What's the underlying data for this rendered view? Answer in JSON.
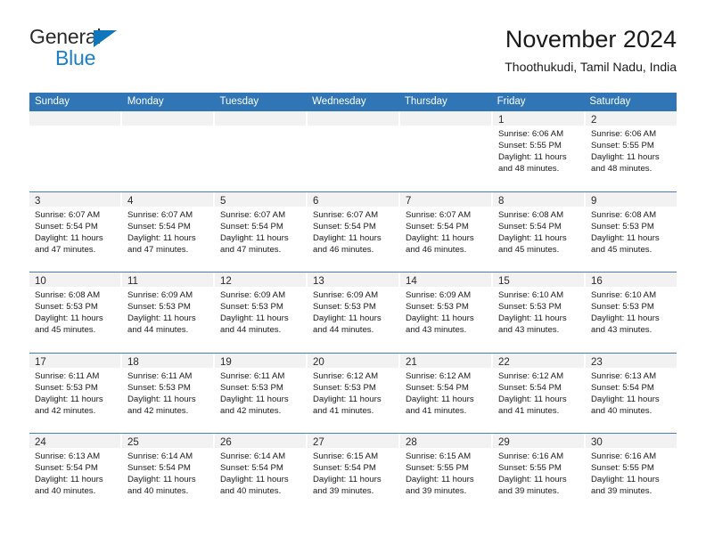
{
  "brand": {
    "name_top": "General",
    "name_bottom": "Blue",
    "accent_color": "#1b80c4"
  },
  "header": {
    "title": "November 2024",
    "subtitle": "Thoothukudi, Tamil Nadu, India"
  },
  "calendar": {
    "header_color": "#3075b5",
    "weekdays": [
      "Sunday",
      "Monday",
      "Tuesday",
      "Wednesday",
      "Thursday",
      "Friday",
      "Saturday"
    ],
    "weeks": [
      [
        {
          "day": "",
          "lines": []
        },
        {
          "day": "",
          "lines": []
        },
        {
          "day": "",
          "lines": []
        },
        {
          "day": "",
          "lines": []
        },
        {
          "day": "",
          "lines": []
        },
        {
          "day": "1",
          "lines": [
            "Sunrise: 6:06 AM",
            "Sunset: 5:55 PM",
            "Daylight: 11 hours",
            "and 48 minutes."
          ]
        },
        {
          "day": "2",
          "lines": [
            "Sunrise: 6:06 AM",
            "Sunset: 5:55 PM",
            "Daylight: 11 hours",
            "and 48 minutes."
          ]
        }
      ],
      [
        {
          "day": "3",
          "lines": [
            "Sunrise: 6:07 AM",
            "Sunset: 5:54 PM",
            "Daylight: 11 hours",
            "and 47 minutes."
          ]
        },
        {
          "day": "4",
          "lines": [
            "Sunrise: 6:07 AM",
            "Sunset: 5:54 PM",
            "Daylight: 11 hours",
            "and 47 minutes."
          ]
        },
        {
          "day": "5",
          "lines": [
            "Sunrise: 6:07 AM",
            "Sunset: 5:54 PM",
            "Daylight: 11 hours",
            "and 47 minutes."
          ]
        },
        {
          "day": "6",
          "lines": [
            "Sunrise: 6:07 AM",
            "Sunset: 5:54 PM",
            "Daylight: 11 hours",
            "and 46 minutes."
          ]
        },
        {
          "day": "7",
          "lines": [
            "Sunrise: 6:07 AM",
            "Sunset: 5:54 PM",
            "Daylight: 11 hours",
            "and 46 minutes."
          ]
        },
        {
          "day": "8",
          "lines": [
            "Sunrise: 6:08 AM",
            "Sunset: 5:54 PM",
            "Daylight: 11 hours",
            "and 45 minutes."
          ]
        },
        {
          "day": "9",
          "lines": [
            "Sunrise: 6:08 AM",
            "Sunset: 5:53 PM",
            "Daylight: 11 hours",
            "and 45 minutes."
          ]
        }
      ],
      [
        {
          "day": "10",
          "lines": [
            "Sunrise: 6:08 AM",
            "Sunset: 5:53 PM",
            "Daylight: 11 hours",
            "and 45 minutes."
          ]
        },
        {
          "day": "11",
          "lines": [
            "Sunrise: 6:09 AM",
            "Sunset: 5:53 PM",
            "Daylight: 11 hours",
            "and 44 minutes."
          ]
        },
        {
          "day": "12",
          "lines": [
            "Sunrise: 6:09 AM",
            "Sunset: 5:53 PM",
            "Daylight: 11 hours",
            "and 44 minutes."
          ]
        },
        {
          "day": "13",
          "lines": [
            "Sunrise: 6:09 AM",
            "Sunset: 5:53 PM",
            "Daylight: 11 hours",
            "and 44 minutes."
          ]
        },
        {
          "day": "14",
          "lines": [
            "Sunrise: 6:09 AM",
            "Sunset: 5:53 PM",
            "Daylight: 11 hours",
            "and 43 minutes."
          ]
        },
        {
          "day": "15",
          "lines": [
            "Sunrise: 6:10 AM",
            "Sunset: 5:53 PM",
            "Daylight: 11 hours",
            "and 43 minutes."
          ]
        },
        {
          "day": "16",
          "lines": [
            "Sunrise: 6:10 AM",
            "Sunset: 5:53 PM",
            "Daylight: 11 hours",
            "and 43 minutes."
          ]
        }
      ],
      [
        {
          "day": "17",
          "lines": [
            "Sunrise: 6:11 AM",
            "Sunset: 5:53 PM",
            "Daylight: 11 hours",
            "and 42 minutes."
          ]
        },
        {
          "day": "18",
          "lines": [
            "Sunrise: 6:11 AM",
            "Sunset: 5:53 PM",
            "Daylight: 11 hours",
            "and 42 minutes."
          ]
        },
        {
          "day": "19",
          "lines": [
            "Sunrise: 6:11 AM",
            "Sunset: 5:53 PM",
            "Daylight: 11 hours",
            "and 42 minutes."
          ]
        },
        {
          "day": "20",
          "lines": [
            "Sunrise: 6:12 AM",
            "Sunset: 5:53 PM",
            "Daylight: 11 hours",
            "and 41 minutes."
          ]
        },
        {
          "day": "21",
          "lines": [
            "Sunrise: 6:12 AM",
            "Sunset: 5:54 PM",
            "Daylight: 11 hours",
            "and 41 minutes."
          ]
        },
        {
          "day": "22",
          "lines": [
            "Sunrise: 6:12 AM",
            "Sunset: 5:54 PM",
            "Daylight: 11 hours",
            "and 41 minutes."
          ]
        },
        {
          "day": "23",
          "lines": [
            "Sunrise: 6:13 AM",
            "Sunset: 5:54 PM",
            "Daylight: 11 hours",
            "and 40 minutes."
          ]
        }
      ],
      [
        {
          "day": "24",
          "lines": [
            "Sunrise: 6:13 AM",
            "Sunset: 5:54 PM",
            "Daylight: 11 hours",
            "and 40 minutes."
          ]
        },
        {
          "day": "25",
          "lines": [
            "Sunrise: 6:14 AM",
            "Sunset: 5:54 PM",
            "Daylight: 11 hours",
            "and 40 minutes."
          ]
        },
        {
          "day": "26",
          "lines": [
            "Sunrise: 6:14 AM",
            "Sunset: 5:54 PM",
            "Daylight: 11 hours",
            "and 40 minutes."
          ]
        },
        {
          "day": "27",
          "lines": [
            "Sunrise: 6:15 AM",
            "Sunset: 5:54 PM",
            "Daylight: 11 hours",
            "and 39 minutes."
          ]
        },
        {
          "day": "28",
          "lines": [
            "Sunrise: 6:15 AM",
            "Sunset: 5:55 PM",
            "Daylight: 11 hours",
            "and 39 minutes."
          ]
        },
        {
          "day": "29",
          "lines": [
            "Sunrise: 6:16 AM",
            "Sunset: 5:55 PM",
            "Daylight: 11 hours",
            "and 39 minutes."
          ]
        },
        {
          "day": "30",
          "lines": [
            "Sunrise: 6:16 AM",
            "Sunset: 5:55 PM",
            "Daylight: 11 hours",
            "and 39 minutes."
          ]
        }
      ]
    ]
  }
}
